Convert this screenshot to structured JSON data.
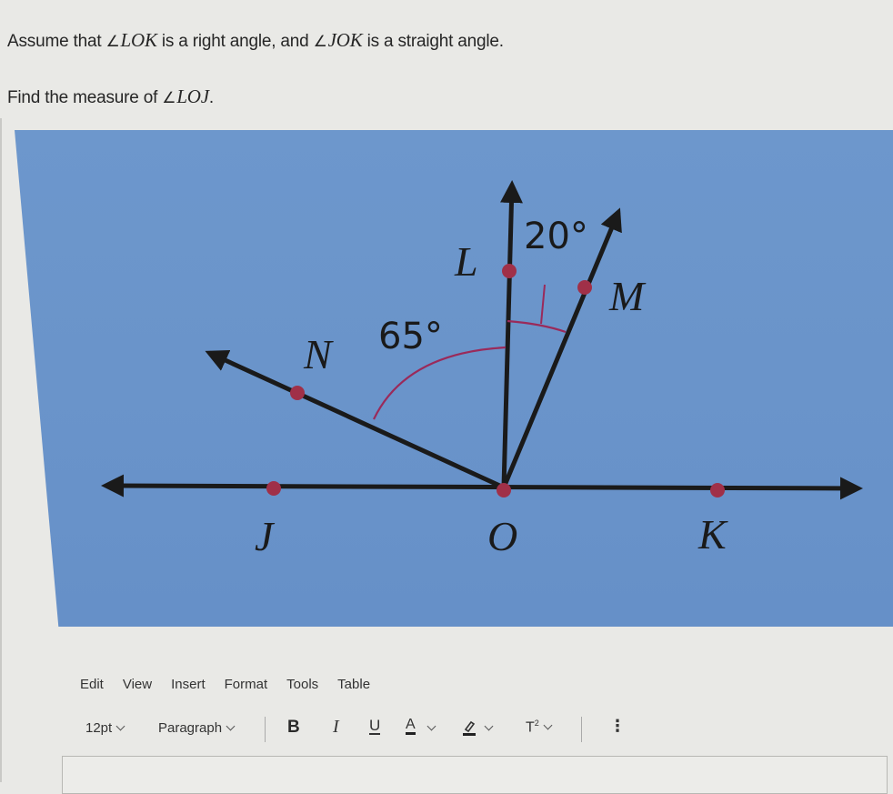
{
  "question": {
    "line1_prefix": "Assume that ",
    "line1_angle1_symbol": "∠",
    "line1_angle1": "LOK",
    "line1_mid": " is a right angle, and ",
    "line1_angle2_symbol": "∠",
    "line1_angle2": "JOK",
    "line1_suffix": " is a straight angle.",
    "line2_prefix": "Find the measure of ",
    "line2_angle_symbol": "∠",
    "line2_angle": "LOJ",
    "line2_suffix": "."
  },
  "figure": {
    "background_color": "#6a94ca",
    "line_color": "#1a1a1a",
    "point_color": "#a03048",
    "arc_color": "#9a2a5a",
    "points": {
      "L": "L",
      "M": "M",
      "N": "N",
      "J": "J",
      "O": "O",
      "K": "K"
    },
    "angle_labels": {
      "LOM": "20°",
      "NOL": "65°"
    }
  },
  "editor": {
    "menu": [
      "Edit",
      "View",
      "Insert",
      "Format",
      "Tools",
      "Table"
    ],
    "toolbar": {
      "font_size": "12pt",
      "block_format": "Paragraph",
      "bold": "B",
      "italic": "I",
      "underline": "U",
      "font_color": "A",
      "superscript_base": "T",
      "superscript_exp": "2",
      "more": "⋮"
    },
    "content": ""
  }
}
